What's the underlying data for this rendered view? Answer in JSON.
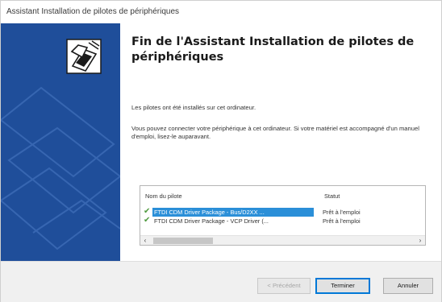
{
  "window": {
    "title": "Assistant Installation de pilotes de périphériques"
  },
  "main": {
    "heading": "Fin de l'Assistant Installation de pilotes de périphériques",
    "paragraph1": "Les pilotes ont été installés sur cet ordinateur.",
    "paragraph2": "Vous pouvez connecter votre périphérique à cet ordinateur. Si votre matériel est accompagné d'un manuel d'emploi, lisez-le auparavant."
  },
  "driver_list": {
    "columns": [
      "Nom du pilote",
      "Statut"
    ],
    "rows": [
      {
        "name": "FTDI CDM Driver Package - Bus/D2XX ...",
        "status": "Prêt à l'emploi",
        "selected": true
      },
      {
        "name": "FTDI CDM Driver Package - VCP Driver (...",
        "status": "Prêt à l'emploi",
        "selected": false
      }
    ],
    "check_icon": "checkmark-icon"
  },
  "buttons": {
    "previous": "< Précédent",
    "finish": "Terminer",
    "cancel": "Annuler"
  },
  "colors": {
    "banner": "#1f4e9a",
    "selection": "#2b8fd8",
    "check": "#4f9a3f"
  }
}
